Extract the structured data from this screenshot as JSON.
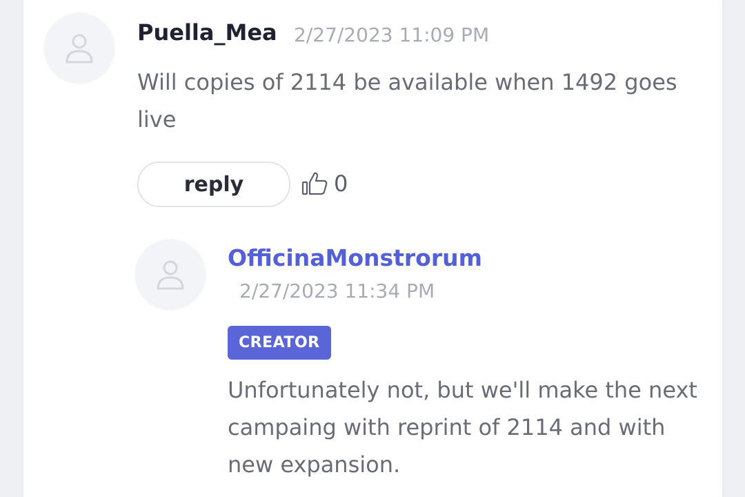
{
  "comments": [
    {
      "author": "Puella_Mea",
      "timestamp": "2/27/2023 11:09 PM",
      "text": "Will copies of 2114 be available when 1492 goes live",
      "reply_label": "reply",
      "like_icon": "thumbs-up-icon",
      "like_count": "0",
      "avatar_icon": "user-icon"
    }
  ],
  "replies": [
    {
      "author": "OfficinaMonstrorum",
      "author_color": "#5460d6",
      "timestamp": "2/27/2023 11:34 PM",
      "badge": "CREATOR",
      "badge_color": "#5a66d8",
      "text": "Unfortunately not, but we'll make the next campaing with reprint of 2114 and with new expansion.",
      "avatar_icon": "user-icon"
    }
  ]
}
